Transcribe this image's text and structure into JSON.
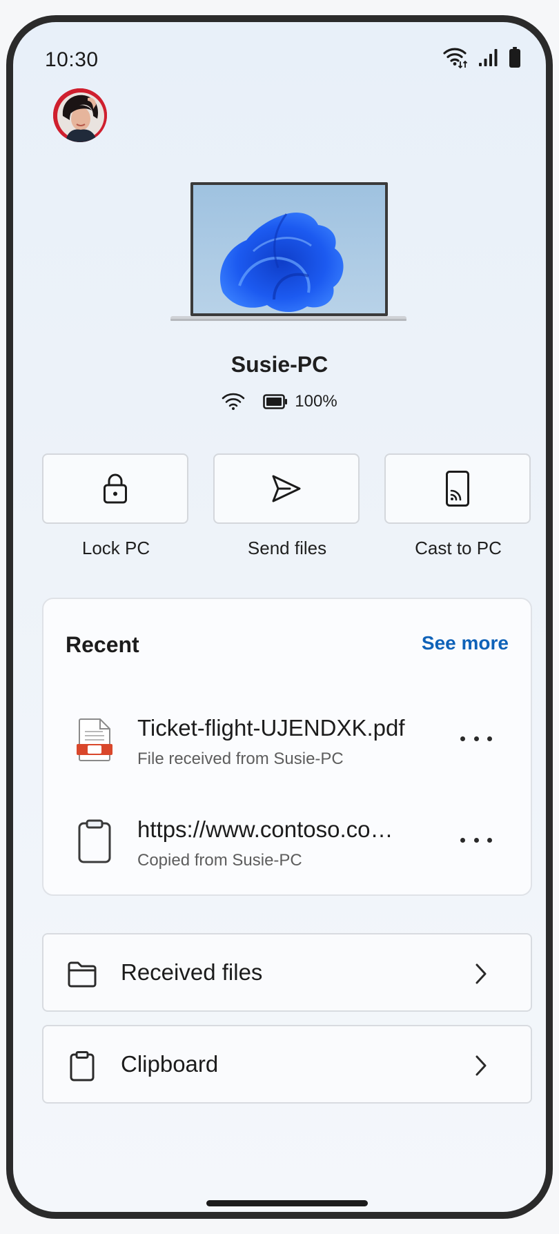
{
  "status_bar": {
    "time": "10:30",
    "icons": [
      "wifi-data-icon",
      "cellular-signal-icon",
      "battery-icon"
    ]
  },
  "profile": {
    "avatar_icon": "user-avatar-photo"
  },
  "device": {
    "name": "Susie-PC",
    "battery_label": "100%",
    "battery_level": 1.0,
    "connection_icon": "wifi-icon"
  },
  "actions": [
    {
      "label": "Lock PC",
      "icon": "lock-icon"
    },
    {
      "label": "Send files",
      "icon": "send-icon"
    },
    {
      "label": "Cast to PC",
      "icon": "cast-icon"
    }
  ],
  "recent": {
    "title": "Recent",
    "see_more": "See more",
    "items": [
      {
        "title": "Ticket-flight-UJENDXK.pdf",
        "subtitle": "File received from Susie-PC",
        "icon": "pdf-file-icon"
      },
      {
        "title": "https://www.contoso.co…",
        "subtitle": "Copied from Susie-PC",
        "icon": "clipboard-icon"
      }
    ]
  },
  "nav": [
    {
      "label": "Received files",
      "icon": "folder-icon"
    },
    {
      "label": "Clipboard",
      "icon": "clipboard-icon"
    }
  ],
  "colors": {
    "accent": "#0f62b8",
    "pdf_red": "#d9472b",
    "frame": "#2b2b2b"
  }
}
